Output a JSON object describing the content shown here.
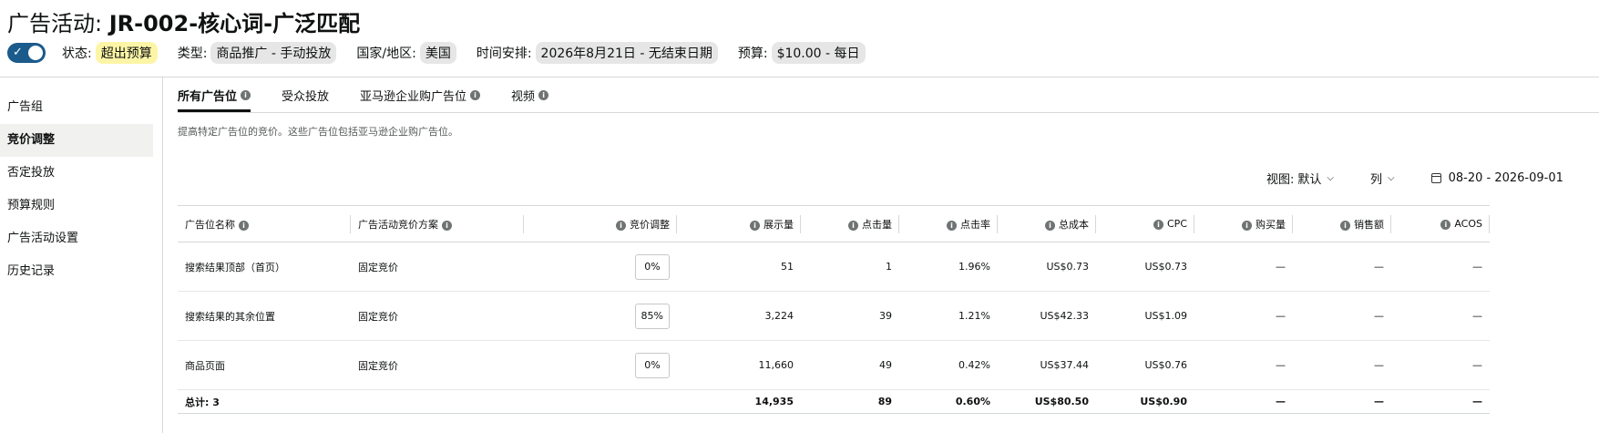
{
  "header": {
    "title_prefix": "广告活动: ",
    "title_name": "JR-002-核心词-广泛匹配"
  },
  "meta": {
    "status_label": "状态:",
    "status_value": "超出预算",
    "type_label": "类型:",
    "type_value": "商品推广 - 手动投放",
    "country_label": "国家/地区:",
    "country_value": "美国",
    "schedule_label": "时间安排:",
    "schedule_value": "2026年8月21日 - 无结束日期",
    "budget_label": "预算:",
    "budget_value": "$10.00 - 每日",
    "colors": {
      "toggle": "#1a5b8c",
      "warn_chip": "#fdf5a6"
    }
  },
  "sidebar": {
    "items": [
      {
        "label": "广告组"
      },
      {
        "label": "竞价调整"
      },
      {
        "label": "否定投放"
      },
      {
        "label": "预算规则"
      },
      {
        "label": "广告活动设置"
      },
      {
        "label": "历史记录"
      }
    ]
  },
  "tabs": [
    {
      "label": "所有广告位"
    },
    {
      "label": "受众投放"
    },
    {
      "label": "亚马逊企业购广告位"
    },
    {
      "label": "视频"
    }
  ],
  "helper_text": "提高特定广告位的竞价。这些广告位包括亚马逊企业购广告位。",
  "view_controls": {
    "view_label": "视图:",
    "view_value": "默认",
    "columns_label": "列",
    "date_range": "08-20 - 2026-09-01"
  },
  "table": {
    "headers": {
      "placement": "广告位名称",
      "strategy": "广告活动竞价方案",
      "bid_adj": "竞价调整",
      "impressions": "展示量",
      "clicks": "点击量",
      "ctr": "点击率",
      "spend": "总成本",
      "cpc": "CPC",
      "orders": "购买量",
      "sales": "销售额",
      "acos": "ACOS"
    },
    "rows": [
      {
        "placement": "搜索结果顶部（首页）",
        "strategy": "固定竞价",
        "bid_adj": "0%",
        "impressions": "51",
        "clicks": "1",
        "ctr": "1.96%",
        "spend": "US$0.73",
        "cpc": "US$0.73",
        "orders": "—",
        "sales": "—",
        "acos": "—"
      },
      {
        "placement": "搜索结果的其余位置",
        "strategy": "固定竞价",
        "bid_adj": "85%",
        "impressions": "3,224",
        "clicks": "39",
        "ctr": "1.21%",
        "spend": "US$42.33",
        "cpc": "US$1.09",
        "orders": "—",
        "sales": "—",
        "acos": "—"
      },
      {
        "placement": "商品页面",
        "strategy": "固定竞价",
        "bid_adj": "0%",
        "impressions": "11,660",
        "clicks": "49",
        "ctr": "0.42%",
        "spend": "US$37.44",
        "cpc": "US$0.76",
        "orders": "—",
        "sales": "—",
        "acos": "—"
      }
    ],
    "total": {
      "label": "总计: 3",
      "impressions": "14,935",
      "clicks": "89",
      "ctr": "0.60%",
      "spend": "US$80.50",
      "cpc": "US$0.90",
      "orders": "—",
      "sales": "—",
      "acos": "—"
    }
  }
}
